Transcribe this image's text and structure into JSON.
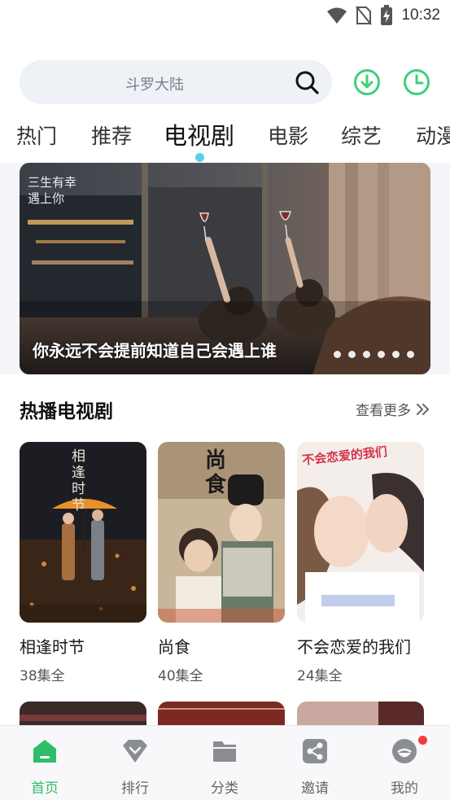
{
  "status_bar": {
    "time": "10:32"
  },
  "search": {
    "placeholder": "斗罗大陆"
  },
  "tabs": [
    {
      "label": "热门"
    },
    {
      "label": "推荐"
    },
    {
      "label": "电视剧",
      "active": true
    },
    {
      "label": "电影"
    },
    {
      "label": "综艺"
    },
    {
      "label": "动漫"
    }
  ],
  "banner": {
    "caption": "你永远不会提前知道自己会遇上谁",
    "poster_title": "三生有幸遇上你",
    "slide_count": 6
  },
  "section": {
    "title": "热播电视剧",
    "see_more": "查看更多"
  },
  "dramas": [
    {
      "title": "相逢时节",
      "episodes": "38集全",
      "poster_text": "相逢时节"
    },
    {
      "title": "尚食",
      "episodes": "40集全",
      "poster_text": "尚食"
    },
    {
      "title": "不会恋爱的我们",
      "episodes": "24集全",
      "poster_text": "不会恋爱的我们"
    }
  ],
  "bottom_nav": [
    {
      "label": "首页",
      "icon": "home-icon",
      "active": true
    },
    {
      "label": "排行",
      "icon": "rank-icon"
    },
    {
      "label": "分类",
      "icon": "folder-icon"
    },
    {
      "label": "邀请",
      "icon": "share-icon"
    },
    {
      "label": "我的",
      "icon": "profile-icon",
      "badge": true
    }
  ],
  "colors": {
    "accent": "#2fbd6a",
    "indicator": "#5ad1e6",
    "badge": "#ee3b3b"
  }
}
